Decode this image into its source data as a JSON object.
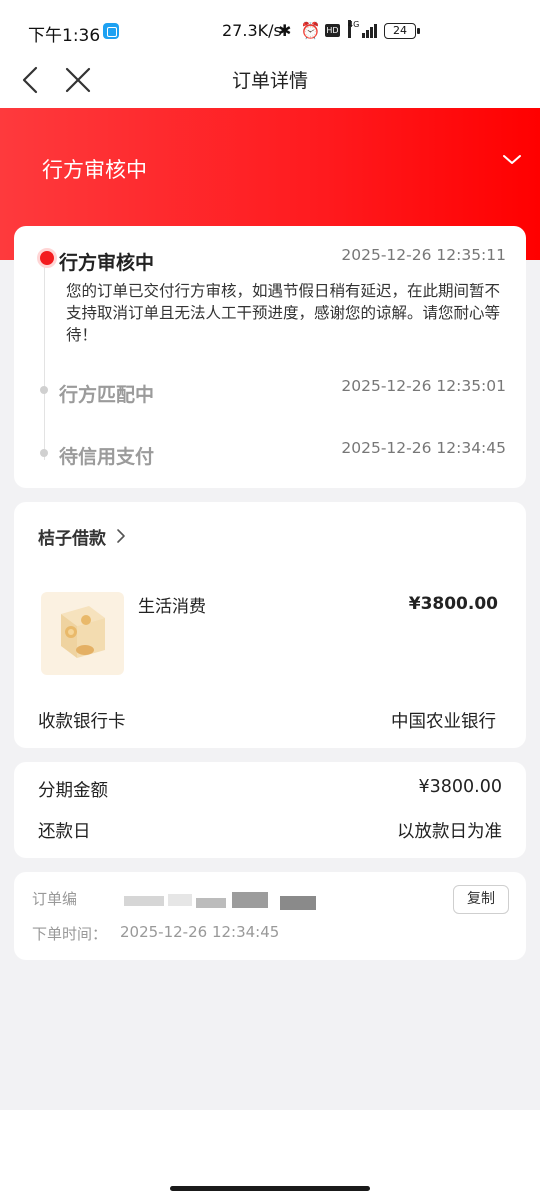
{
  "status_bar": {
    "time": "下午1:36",
    "net_speed": "27.3K/s",
    "sys_icons": "✱ ⏰",
    "hd_label": "HD",
    "network_label": "4G",
    "battery": "24"
  },
  "nav": {
    "title": "订单详情",
    "back_icon": "chevron-left-icon",
    "close_icon": "close-icon"
  },
  "hero": {
    "status_title": "行方审核中",
    "expand_icon": "chevron-down-icon"
  },
  "timeline": [
    {
      "title": "行方审核中",
      "time": "2025-12-26 12:35:11",
      "desc": "您的订单已交付行方审核，如遇节假日稍有延迟，在此期间暂不支持取消订单且无法人工干预进度，感谢您的谅解。请您耐心等待！",
      "active": true
    },
    {
      "title": "行方匹配中",
      "time": "2025-12-26 12:35:01",
      "active": false
    },
    {
      "title": "待信用支付",
      "time": "2025-12-26 12:34:45",
      "active": false
    }
  ],
  "product": {
    "merchant": "桔子借款",
    "name": "生活消费",
    "price": "¥3800.00",
    "bank_label": "收款银行卡",
    "bank_value": "中国农业银行"
  },
  "amount": {
    "installment_label": "分期金额",
    "installment_value": "¥3800.00",
    "repay_label": "还款日",
    "repay_value": "以放款日为准"
  },
  "order": {
    "number_label": "订单编",
    "copy_label": "复制",
    "time_label": "下单时间：",
    "time_value": "2025-12-26 12:34:45"
  },
  "colors": {
    "accent": "#ff1a1e",
    "page_bg": "#f2f2f4"
  }
}
